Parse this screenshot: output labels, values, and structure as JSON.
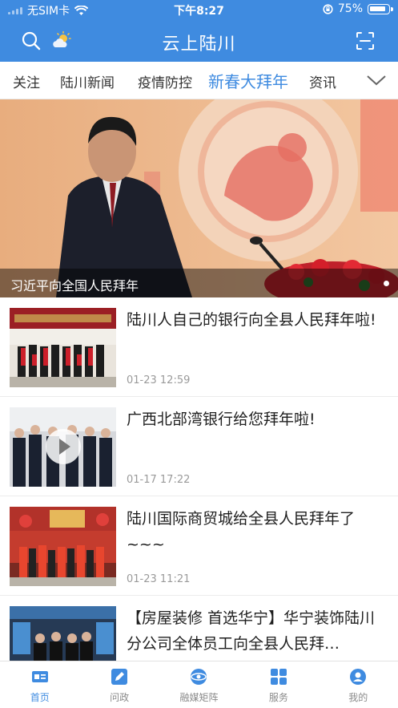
{
  "status_bar": {
    "carrier": "无SIM卡",
    "time": "下午8:27",
    "battery": "75%"
  },
  "header": {
    "title": "云上陆川",
    "icons": {
      "search": "search-icon",
      "weather": "weather-icon",
      "scan": "scan-icon"
    }
  },
  "tabs": {
    "items": [
      {
        "label": "关注"
      },
      {
        "label": "陆川新闻"
      },
      {
        "label": "疫情防控"
      },
      {
        "label": "新春大拜年"
      },
      {
        "label": "资讯"
      }
    ],
    "active_index": 3
  },
  "hero": {
    "caption": "习近平向全国人民拜年"
  },
  "news": [
    {
      "title": "陆川人自己的银行向全县人民拜年啦!",
      "time": "01-23 12:59",
      "has_video": false
    },
    {
      "title": "广西北部湾银行给您拜年啦!",
      "time": "01-17 17:22",
      "has_video": true
    },
    {
      "title": "陆川国际商贸城给全县人民拜年了~~~",
      "time": "01-23 11:21",
      "has_video": false
    },
    {
      "title": "【房屋装修 首选华宁】华宁装饰陆川分公司全体员工向全县人民拜…",
      "time": "",
      "has_video": false
    }
  ],
  "bottom_nav": {
    "items": [
      {
        "label": "首页",
        "icon": "home-icon"
      },
      {
        "label": "问政",
        "icon": "inquiry-icon"
      },
      {
        "label": "融媒矩阵",
        "icon": "media-matrix-icon"
      },
      {
        "label": "服务",
        "icon": "services-icon"
      },
      {
        "label": "我的",
        "icon": "profile-icon"
      }
    ],
    "active_index": 0
  },
  "colors": {
    "brand_blue": "#3f8be0",
    "text_dark": "#1f1f1f",
    "text_muted": "#9a9a9a"
  }
}
